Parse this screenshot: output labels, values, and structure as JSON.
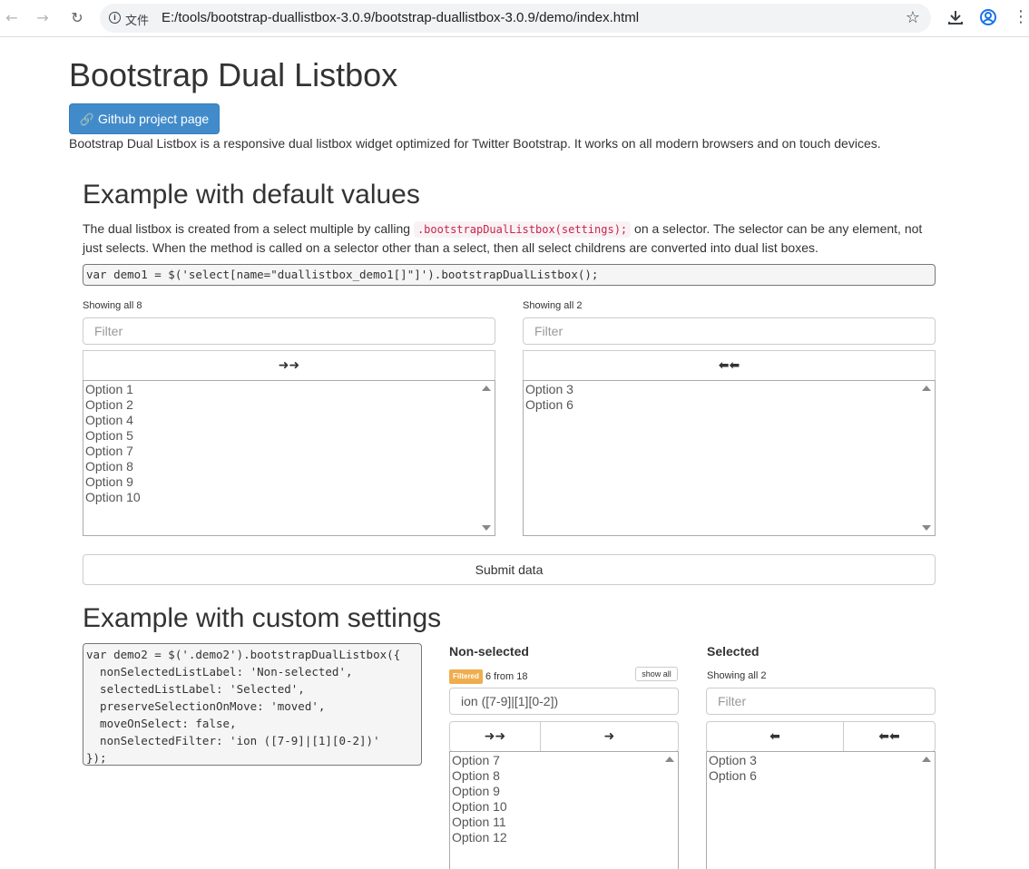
{
  "browser": {
    "back_icon": "←",
    "forward_icon": "→",
    "reload_icon": "↻",
    "url_label": "文件",
    "url": "E:/tools/bootstrap-duallistbox-3.0.9/bootstrap-duallistbox-3.0.9/demo/index.html"
  },
  "page": {
    "title": "Bootstrap Dual Listbox",
    "github_button": "Github project page",
    "intro": "Bootstrap Dual Listbox is a responsive dual listbox widget optimized for Twitter Bootstrap. It works on all modern browsers and on touch devices."
  },
  "demo1": {
    "title": "Example with default values",
    "desc_before": "The dual listbox is created from a select multiple by calling ",
    "desc_code": ".bootstrapDualListbox(settings);",
    "desc_after": " on a selector. The selector can be any element, not just selects. When the method is called on a selector other than a select, then all select childrens are converted into dual list boxes.",
    "code": "var demo1 = $('select[name=\"duallistbox_demo1[]\"]').bootstrapDualListbox();",
    "nonselected": {
      "info": "Showing all 8",
      "filter_placeholder": "Filter",
      "move_all_label": "➜➜",
      "options": [
        "Option 1",
        "Option 2",
        "Option 4",
        "Option 5",
        "Option 7",
        "Option 8",
        "Option 9",
        "Option 10"
      ]
    },
    "selected": {
      "info": "Showing all 2",
      "filter_placeholder": "Filter",
      "remove_all_label": "⬅⬅",
      "options": [
        "Option 3",
        "Option 6"
      ]
    },
    "submit_label": "Submit data"
  },
  "demo2": {
    "title": "Example with custom settings",
    "code_lines": [
      "var demo2 = $('.demo2').bootstrapDualListbox({",
      "  nonSelectedListLabel: 'Non-selected',",
      "  selectedListLabel: 'Selected',",
      "  preserveSelectionOnMove: 'moved',",
      "  moveOnSelect: false,",
      "  nonSelectedFilter: 'ion ([7-9]|[1][0-2])'",
      "});"
    ],
    "nonselected": {
      "heading": "Non-selected",
      "badge": "Filtered",
      "info": "6 from 18",
      "show_all": "show all",
      "filter_value": "ion ([7-9]|[1][0-2])",
      "move_all_label": "➜➜",
      "move_label": "➜",
      "options": [
        "Option 7",
        "Option 8",
        "Option 9",
        "Option 10",
        "Option 11",
        "Option 12"
      ]
    },
    "selected": {
      "heading": "Selected",
      "info": "Showing all 2",
      "filter_placeholder": "Filter",
      "remove_label": "⬅",
      "remove_all_label": "⬅⬅",
      "options": [
        "Option 3",
        "Option 6"
      ]
    }
  },
  "colors": {
    "primary": "#428bca",
    "code_red": "#c7254e",
    "badge_warning": "#f0ad4e"
  }
}
